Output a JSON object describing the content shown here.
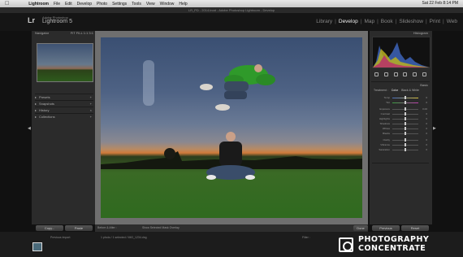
{
  "menubar": {
    "apple": "",
    "app_name": "Lightroom",
    "items": [
      "File",
      "Edit",
      "Develop",
      "Photo",
      "Settings",
      "Tools",
      "View",
      "Window",
      "Help"
    ],
    "status": "Sat 22 Feb  8:14 PM"
  },
  "window": {
    "title": "LR_PD - 2014.lrcat - Adobe Photoshop Lightroom - Develop"
  },
  "identity": {
    "logo": "Lr",
    "vendor": "Adobe Photoshop",
    "product": "Lightroom 5"
  },
  "modules": [
    "Library",
    "Develop",
    "Map",
    "Book",
    "Slideshow",
    "Print",
    "Web"
  ],
  "active_module": "Develop",
  "left_panel": {
    "navigator_label": "Navigator",
    "navigator_options": "FIT  FILL  1:1  3:1",
    "panels": [
      "Presets",
      "Snapshots",
      "History",
      "Collections"
    ],
    "copy_label": "Copy...",
    "paste_label": "Paste"
  },
  "toolbar": {
    "before_after": "Before & After :",
    "show_selected": "Show Selected Mask Overlay"
  },
  "right_panel": {
    "histogram_label": "Histogram",
    "basic_label": "Basic",
    "treatment": "Treatment :",
    "color": "Color",
    "bw": "Black & White",
    "sliders": [
      {
        "label": "Temp",
        "value": "0"
      },
      {
        "label": "Tint",
        "value": "0"
      },
      {
        "label": "Exposure",
        "value": "0.00"
      },
      {
        "label": "Contrast",
        "value": "0"
      },
      {
        "label": "Highlights",
        "value": "0"
      },
      {
        "label": "Shadows",
        "value": "0"
      },
      {
        "label": "Whites",
        "value": "0"
      },
      {
        "label": "Blacks",
        "value": "0"
      },
      {
        "label": "Clarity",
        "value": "0"
      },
      {
        "label": "Vibrance",
        "value": "0"
      },
      {
        "label": "Saturation",
        "value": "0"
      }
    ],
    "previous_label": "Previous",
    "reset_label": "Reset",
    "done_label": "Done"
  },
  "filmstrip": {
    "source": "Previous Import",
    "count": "1 photo / 1 selected / IMG_1234.dng",
    "filter": "Filter :"
  },
  "watermark": {
    "line1": "PHOTOGRAPHY",
    "line2": "CONCENTRATE"
  }
}
